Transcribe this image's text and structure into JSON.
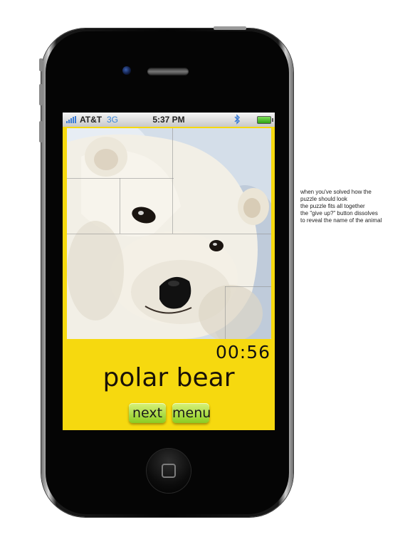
{
  "status_bar": {
    "carrier": "AT&T",
    "network": "3G",
    "time": "5:37 PM",
    "bluetooth_icon": "bluetooth-icon",
    "battery_icon": "battery-icon"
  },
  "puzzle": {
    "image_subject": "polar-bear-photo"
  },
  "game": {
    "timer": "00:56",
    "animal_name": "polar bear",
    "next_label": "next",
    "menu_label": "menu"
  },
  "annotation": {
    "lines": [
      "when you've solved how the",
      "puzzle should look",
      "the puzzle fits all together",
      "the \"give up?\" button dissolves",
      "to reveal the name of the animal"
    ]
  },
  "colors": {
    "screen_yellow": "#f6d90f",
    "button_green": "#9bd42c",
    "network_blue": "#3a86d8"
  }
}
